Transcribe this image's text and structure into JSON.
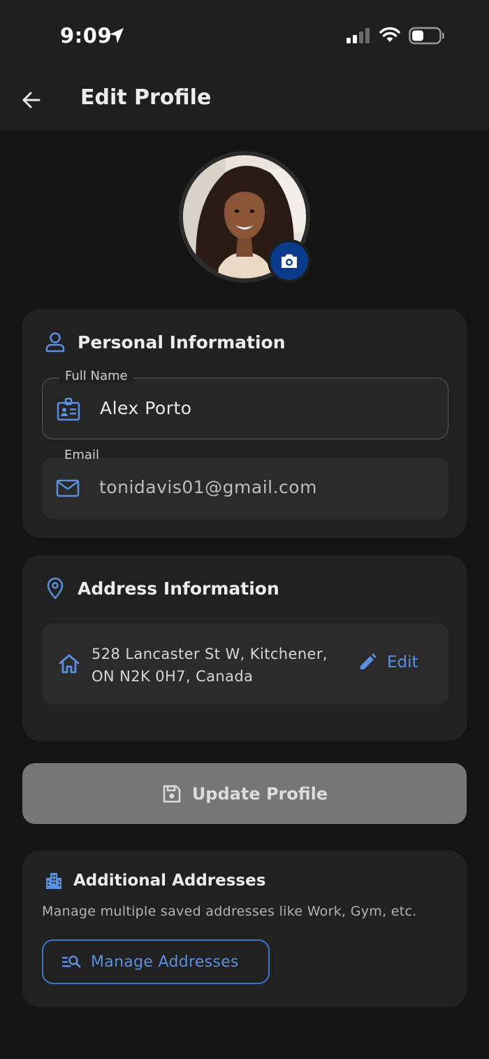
{
  "status_bar": {
    "time": "9:09"
  },
  "header": {
    "title": "Edit Profile"
  },
  "colors": {
    "accent": "#5b8fe0",
    "camera_button": "#0a3a8a",
    "background": "#141414",
    "card": "#212121",
    "update_button": "#767676"
  },
  "personal": {
    "title": "Personal Information",
    "full_name": {
      "label": "Full Name",
      "value": "Alex Porto"
    },
    "email": {
      "label": "Email",
      "value": "tonidavis01@gmail.com"
    }
  },
  "address": {
    "title": "Address Information",
    "line1": "528 Lancaster St W, Kitchener,",
    "line2": "ON N2K 0H7, Canada",
    "edit_label": "Edit"
  },
  "update": {
    "label": "Update Profile"
  },
  "additional": {
    "title": "Additional Addresses",
    "description": "Manage multiple saved addresses like Work, Gym, etc.",
    "button_label": "Manage Addresses"
  }
}
